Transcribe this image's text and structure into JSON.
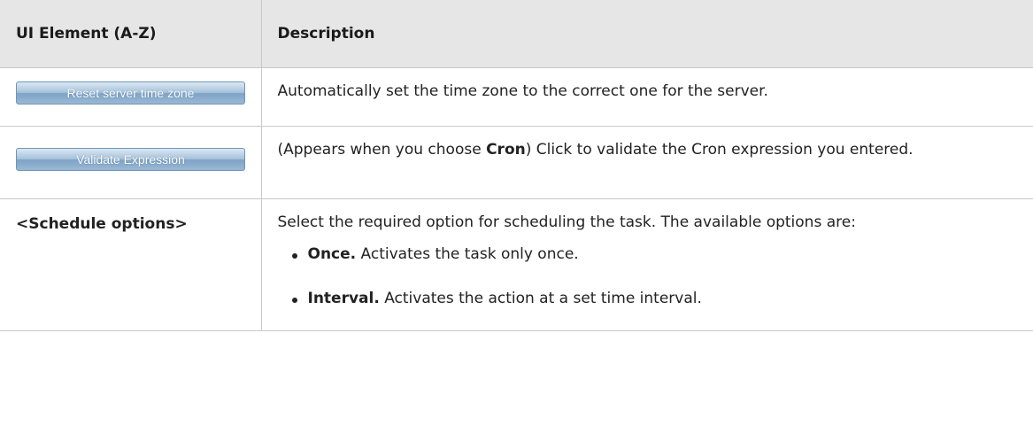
{
  "table": {
    "header": {
      "col1": "UI Element (A-Z)",
      "col2": "Description"
    },
    "rows": [
      {
        "button_label": "Reset server time zone",
        "description": "Automatically set the time zone to the correct one for the server."
      },
      {
        "button_label": "Validate Expression",
        "description_prefix": "(Appears when you choose ",
        "description_bold": "Cron",
        "description_suffix": ") Click to validate the Cron expression you entered."
      },
      {
        "element": "<Schedule options>",
        "description": "Select the required option for scheduling the task. The available options are:",
        "options": [
          {
            "name": "Once.",
            "text": " Activates the task only once."
          },
          {
            "name": "Interval.",
            "text": " Activates the action at a set time interval."
          }
        ]
      }
    ]
  },
  "colors": {
    "header_bg": "#e6e6e6",
    "border": "#c8c8c8",
    "button_blue": "#7ea3c6"
  }
}
